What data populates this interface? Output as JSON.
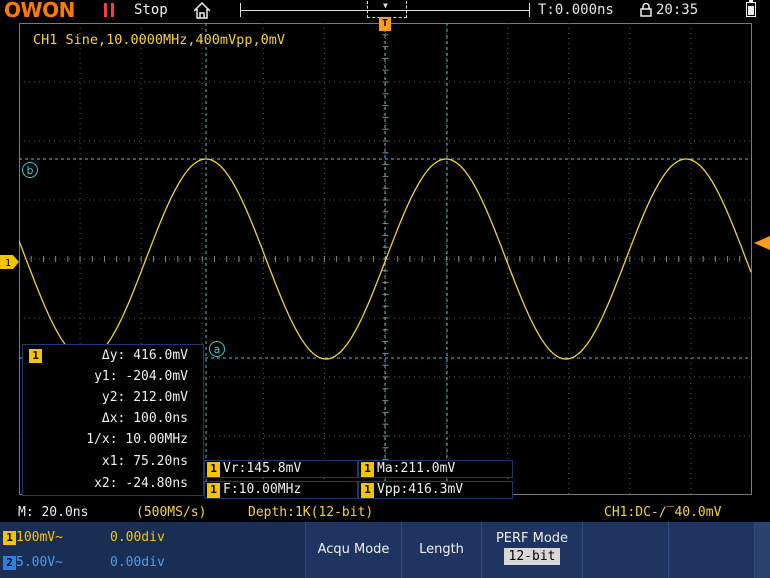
{
  "topbar": {
    "logo": "OWON",
    "run_state": "Stop",
    "trigger_time": "T:0.000ns",
    "clock": "20:35"
  },
  "waveform": {
    "channel_info": "CH1 Sine,10.0000MHz,400mVpp,0mV",
    "trigger_marker": "T",
    "cursor_a_label": "a",
    "cursor_b_label": "b",
    "trace_color": "#f2d23c",
    "grid_color": "#8a8a8a",
    "cursor_color": "#3cc9d6"
  },
  "cursor_measure": {
    "channel_badge": "1",
    "rows": [
      {
        "label": "Δy:",
        "value": "416.0mV"
      },
      {
        "label": "y1:",
        "value": "-204.0mV"
      },
      {
        "label": "y2:",
        "value": "212.0mV"
      },
      {
        "label": "Δx:",
        "value": "100.0ns"
      },
      {
        "label": "1/x:",
        "value": "10.00MHz"
      },
      {
        "label": "x1:",
        "value": "75.20ns"
      },
      {
        "label": "x2:",
        "value": "-24.80ns"
      }
    ]
  },
  "measurements": [
    {
      "badge": "1",
      "text": "Vr:145.8mV"
    },
    {
      "badge": "1",
      "text": "Ma:211.0mV"
    },
    {
      "badge": "1",
      "text": "F:10.00MHz"
    },
    {
      "badge": "1",
      "text": "Vpp:416.3mV"
    }
  ],
  "status": {
    "timebase": "M: 20.0ns",
    "sample_rate": "(500MS/s)",
    "depth": "Depth:1K(12-bit)",
    "trigger": "CH1:DC-∕‾40.0mV"
  },
  "channels": [
    {
      "badge": "1",
      "scale": "100mV~",
      "offset": "0.00div",
      "color": "#f5c400"
    },
    {
      "badge": "2",
      "scale": "5.00V~",
      "offset": "0.00div",
      "color": "#4a9cf0"
    }
  ],
  "menu": {
    "acqu_mode": "Acqu Mode",
    "length": "Length",
    "perf_mode": "PERF Mode",
    "perf_value": "12-bit"
  }
}
